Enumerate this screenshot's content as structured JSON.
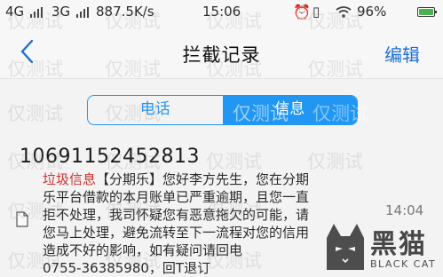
{
  "status_bar": {
    "network1": "4G",
    "network2": "3G",
    "speed": "887.5K/s",
    "time": "15:06",
    "battery": "96%"
  },
  "nav": {
    "title": "拦截记录",
    "edit_label": "编辑"
  },
  "tabs": [
    {
      "label": "电话",
      "active": false
    },
    {
      "label": "信息",
      "active": true
    }
  ],
  "message": {
    "sender": "10691152452813",
    "tag": "垃圾信息",
    "body_lines": [
      "【分期乐】您好李方先生，您在分期",
      "乐平台借款的本月账单已严重逾期，且您一直",
      "拒不处理，我司怀疑您有恶意拖欠的可能，请",
      "您马上处理，避免流转至下一流程对您的信用",
      "造成不好的影响，如有疑问请回电",
      "0755-36385980，回T退订"
    ],
    "time": "14:04"
  },
  "watermark_text": "仅测试",
  "brand": {
    "name": "黑猫",
    "name_en": "BLACK CAT"
  },
  "colors": {
    "accent": "#2196f3",
    "spam_tag": "#d32f2f"
  }
}
